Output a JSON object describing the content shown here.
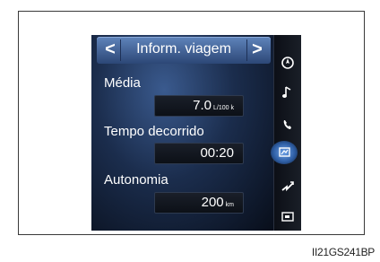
{
  "screen": {
    "header": {
      "title": "Inform. viagem",
      "prev_label": "<",
      "next_label": ">"
    },
    "fields": [
      {
        "label": "Média",
        "value": "7.0",
        "unit": "L/100 k"
      },
      {
        "label": "Tempo decorrido",
        "value": "00:20",
        "unit": ""
      },
      {
        "label": "Autonomia",
        "value": "200",
        "unit": "km"
      }
    ],
    "sidebar": {
      "icons": [
        "navigation-icon",
        "music-icon",
        "phone-icon",
        "info-icon",
        "route-icon",
        "screen-icon"
      ],
      "active": "info-icon"
    }
  },
  "caption": "II21GS241BP"
}
